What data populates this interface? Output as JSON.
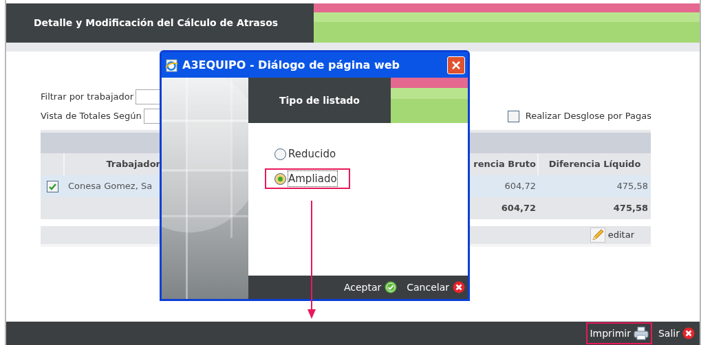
{
  "page": {
    "title": "Detalle y Modificación del Cálculo de Atrasos",
    "filters": [
      {
        "label": "Filtrar por trabajador"
      },
      {
        "label": "Vista de Totales Según"
      }
    ],
    "breakdown": {
      "label": "Realizar Desglose por Pagas",
      "checked": false
    },
    "table": {
      "columns": [
        "Trabajador",
        "rencia Bruto",
        "Diferencia Líquido"
      ],
      "rows": [
        {
          "checked": true,
          "worker": "Conesa Gomez, Sa",
          "gross": "604,72",
          "net": "475,58"
        }
      ],
      "totals": {
        "gross": "604,72",
        "net": "475,58"
      },
      "edit_label": "editar"
    },
    "footer": {
      "buttons": [
        {
          "label": "Imprimir",
          "kind": "print",
          "highlighted": true
        },
        {
          "label": "Salir",
          "kind": "exit",
          "highlighted": false
        }
      ]
    }
  },
  "dialog": {
    "title": "A3EQUIPO - Diálogo de página web",
    "heading": "Tipo de listado",
    "options": [
      {
        "label": "Reducido",
        "selected": false,
        "highlighted": false
      },
      {
        "label": "Ampliado",
        "selected": true,
        "highlighted": true
      }
    ],
    "buttons": [
      {
        "label": "Aceptar",
        "kind": "accept"
      },
      {
        "label": "Cancelar",
        "kind": "cancel"
      }
    ]
  }
}
